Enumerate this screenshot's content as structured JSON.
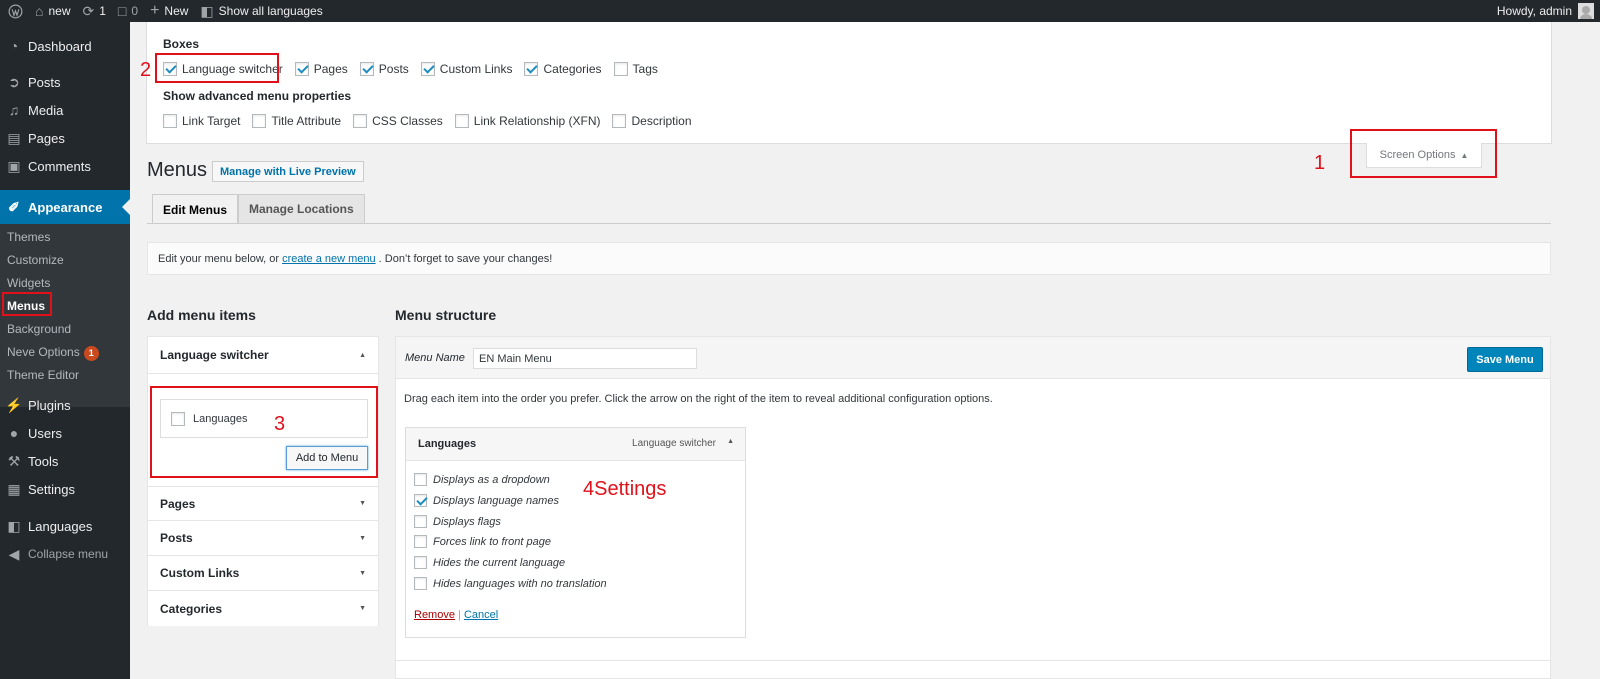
{
  "adminbar": {
    "site_name": "new",
    "updates_count": "1",
    "comments_count": "0",
    "new_label": "New",
    "show_all_languages": "Show all languages",
    "howdy": "Howdy, admin"
  },
  "sidebar": {
    "items": [
      {
        "label": "Dashboard",
        "icon": "dashboard-icon"
      },
      {
        "label": "Posts",
        "icon": "pin-icon"
      },
      {
        "label": "Media",
        "icon": "media-icon"
      },
      {
        "label": "Pages",
        "icon": "page-icon"
      },
      {
        "label": "Comments",
        "icon": "comment-icon"
      },
      {
        "label": "Appearance",
        "icon": "brush-icon"
      },
      {
        "label": "Plugins",
        "icon": "plug-icon"
      },
      {
        "label": "Users",
        "icon": "user-icon"
      },
      {
        "label": "Tools",
        "icon": "wrench-icon"
      },
      {
        "label": "Settings",
        "icon": "settings-icon"
      },
      {
        "label": "Languages",
        "icon": "translate-icon"
      }
    ],
    "submenu": [
      {
        "label": "Themes"
      },
      {
        "label": "Customize"
      },
      {
        "label": "Widgets"
      },
      {
        "label": "Menus"
      },
      {
        "label": "Background"
      },
      {
        "label": "Neve Options",
        "badge": "1"
      },
      {
        "label": "Theme Editor"
      }
    ],
    "collapse_label": "Collapse menu"
  },
  "screen_options": {
    "boxes_heading": "Boxes",
    "boxes": [
      {
        "label": "Language switcher",
        "checked": true
      },
      {
        "label": "Pages",
        "checked": true
      },
      {
        "label": "Posts",
        "checked": true
      },
      {
        "label": "Custom Links",
        "checked": true
      },
      {
        "label": "Categories",
        "checked": true
      },
      {
        "label": "Tags",
        "checked": false
      }
    ],
    "advanced_heading": "Show advanced menu properties",
    "advanced": [
      {
        "label": "Link Target",
        "checked": false
      },
      {
        "label": "Title Attribute",
        "checked": false
      },
      {
        "label": "CSS Classes",
        "checked": false
      },
      {
        "label": "Link Relationship (XFN)",
        "checked": false
      },
      {
        "label": "Description",
        "checked": false
      }
    ],
    "button_label": "Screen Options"
  },
  "annotations": {
    "one": "1",
    "two": "2",
    "three": "3",
    "four": "4Settings"
  },
  "page": {
    "title": "Menus",
    "live_preview": "Manage with Live Preview",
    "tabs": [
      {
        "label": "Edit Menus"
      },
      {
        "label": "Manage Locations"
      }
    ],
    "notice_before": "Edit your menu below, or",
    "notice_link": "create a new menu",
    "notice_after": ". Don’t forget to save your changes!"
  },
  "add_items": {
    "title": "Add menu items",
    "language_switcher": "Language switcher",
    "languages_checkbox": "Languages",
    "add_button": "Add to Menu",
    "sections": [
      {
        "label": "Pages"
      },
      {
        "label": "Posts"
      },
      {
        "label": "Custom Links"
      },
      {
        "label": "Categories"
      }
    ]
  },
  "menu_structure": {
    "title": "Menu structure",
    "menu_name_label": "Menu Name",
    "menu_name_value": "EN Main Menu",
    "save_button": "Save Menu",
    "instructions": "Drag each item into the order you prefer. Click the arrow on the right of the item to reveal additional configuration options.",
    "item": {
      "title": "Languages",
      "type": "Language switcher",
      "options": [
        {
          "label": "Displays as a dropdown",
          "checked": false
        },
        {
          "label": "Displays language names",
          "checked": true
        },
        {
          "label": "Displays flags",
          "checked": false
        },
        {
          "label": "Forces link to front page",
          "checked": false
        },
        {
          "label": "Hides the current language",
          "checked": false
        },
        {
          "label": "Hides languages with no translation",
          "checked": false
        }
      ],
      "remove": "Remove",
      "separator": "|",
      "cancel": "Cancel"
    }
  },
  "colors": {
    "accent": "#0073aa",
    "annotation": "#e0111b",
    "sidebar_bg": "#23282d"
  }
}
